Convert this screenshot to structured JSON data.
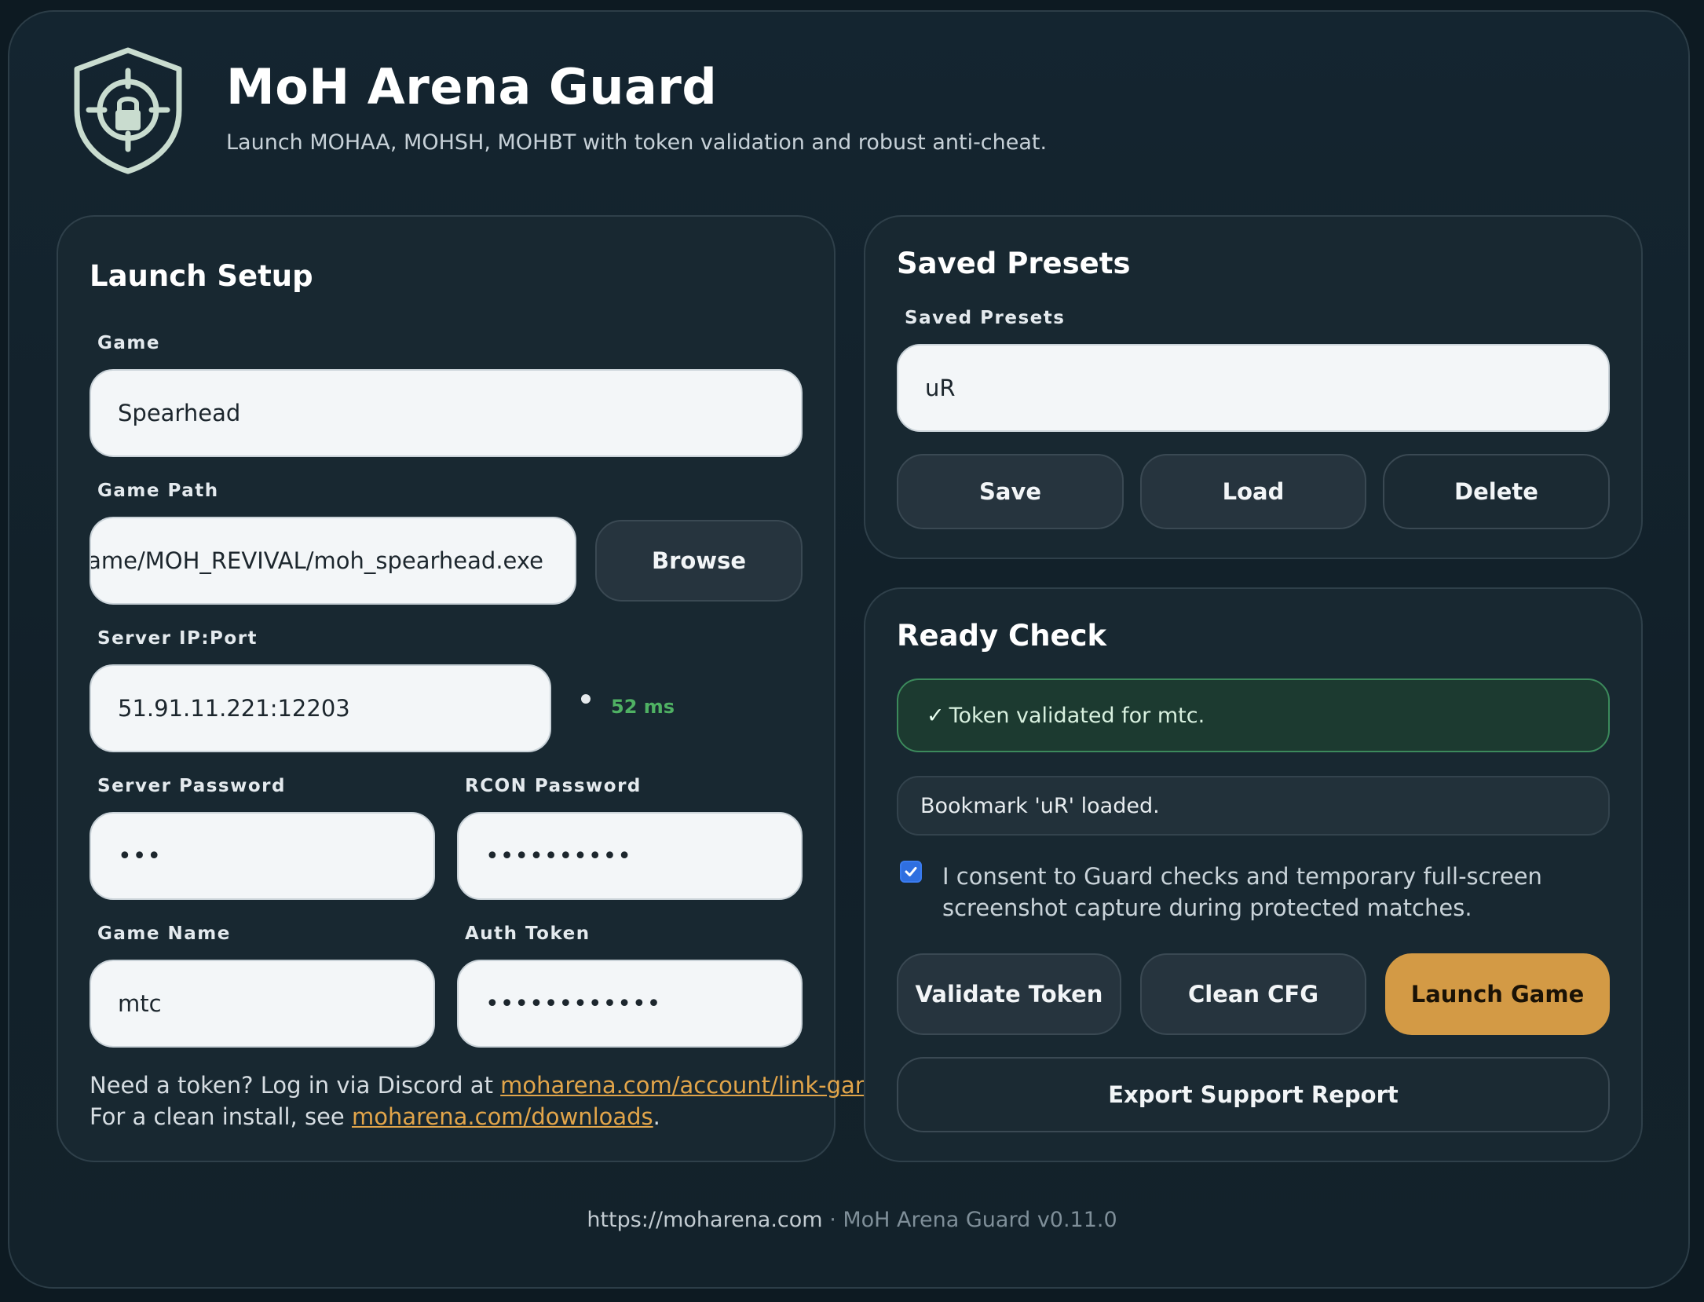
{
  "header": {
    "title": "MoH Arena Guard",
    "subtitle": "Launch MOHAA, MOHSH, MOHBT with token validation and robust anti-cheat."
  },
  "launch_setup": {
    "title": "Launch Setup",
    "game_label": "Game",
    "game_value": "Spearhead",
    "game_path_label": "Game Path",
    "game_path_value": "game/MOH_REVIVAL/moh_spearhead.exe",
    "browse_label": "Browse",
    "server_label": "Server IP:Port",
    "server_value": "51.91.11.221:12203",
    "ping": "52 ms",
    "server_password_label": "Server Password",
    "server_password_value": "•••",
    "rcon_password_label": "RCON Password",
    "rcon_password_value": "••••••••••",
    "game_name_label": "Game Name",
    "game_name_value": "mtc",
    "auth_token_label": "Auth Token",
    "auth_token_value": "••••••••••••",
    "note_line1_prefix": "Need a token? Log in via Discord at ",
    "note_link1": "moharena.com/account/link-game",
    "note_line1_suffix": ".",
    "note_line2_prefix": "For a clean install, see ",
    "note_link2": "moharena.com/downloads",
    "note_line2_suffix": "."
  },
  "saved_presets": {
    "title": "Saved Presets",
    "field_label": "Saved Presets",
    "value": "uR",
    "save_label": "Save",
    "load_label": "Load",
    "delete_label": "Delete"
  },
  "ready_check": {
    "title": "Ready Check",
    "token_status_check": "✓",
    "token_status": "Token validated for mtc.",
    "bookmark_status": "Bookmark 'uR' loaded.",
    "consent_checked": true,
    "consent_text": "I consent to Guard checks and temporary full-screen screenshot capture during protected matches.",
    "validate_label": "Validate Token",
    "clean_label": "Clean CFG",
    "launch_label": "Launch Game",
    "export_label": "Export Support Report"
  },
  "footer": {
    "url": "https://moharena.com",
    "separator": " · ",
    "version": "MoH Arena Guard v0.11.0"
  },
  "colors": {
    "accent": "#d39a45",
    "success": "#4fb163",
    "link": "#e2a54a",
    "checkbox": "#2f6fe0"
  },
  "icons": {
    "logo": "shield-lock-crosshair-icon",
    "checkbox": "check-icon"
  }
}
